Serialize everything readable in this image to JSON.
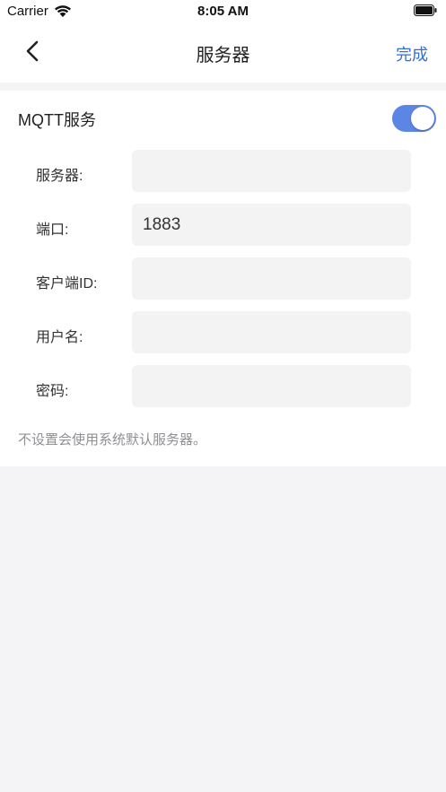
{
  "status_bar": {
    "carrier": "Carrier",
    "time": "8:05 AM"
  },
  "nav": {
    "title": "服务器",
    "done_label": "完成"
  },
  "mqtt": {
    "label": "MQTT服务",
    "enabled": true
  },
  "form": {
    "server_label": "服务器:",
    "server_value": "",
    "port_label": "端口:",
    "port_value": "1883",
    "client_id_label": "客户端ID:",
    "client_id_value": "",
    "username_label": "用户名:",
    "username_value": "",
    "password_label": "密码:",
    "password_value": ""
  },
  "hint": "不设置会使用系统默认服务器。",
  "colors": {
    "accent": "#2f6fe2",
    "toggle_on": "#5b86e5",
    "background": "#f4f4f6"
  }
}
